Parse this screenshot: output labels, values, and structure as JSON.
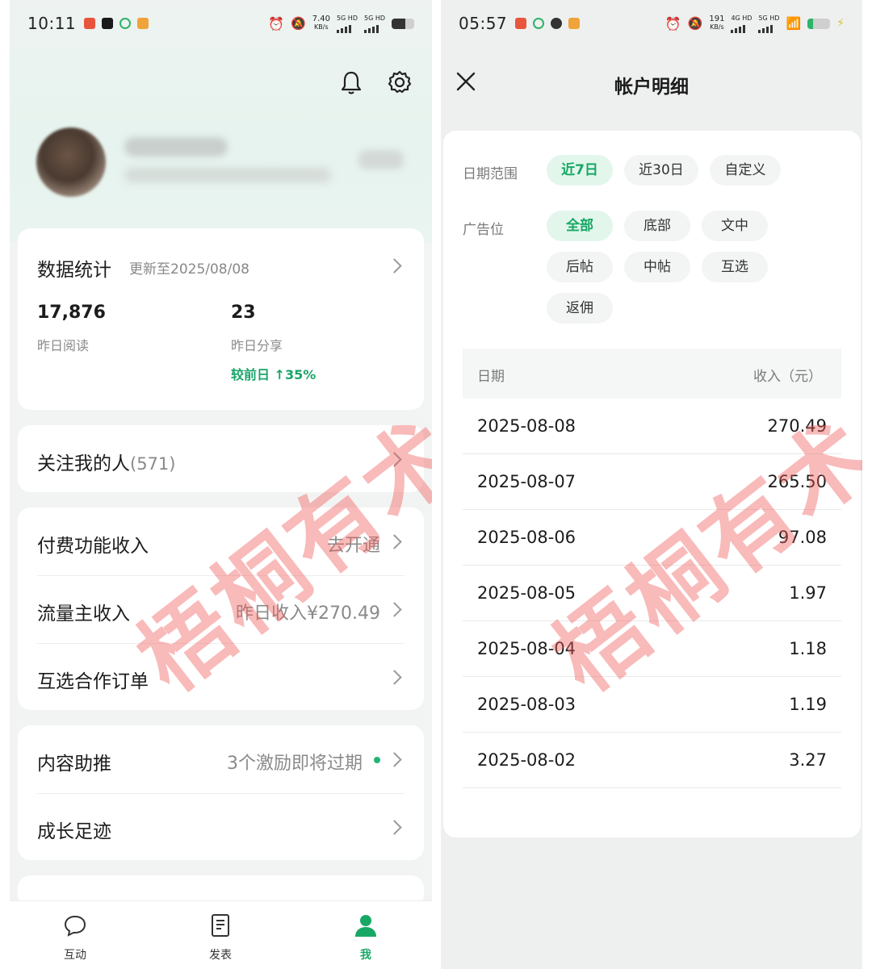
{
  "left": {
    "status": {
      "time": "10:11",
      "net_speed": "7.40",
      "net_unit": "KB/s",
      "sim1": "5G HD",
      "sim2": "5G HD"
    },
    "stats": {
      "title": "数据统计",
      "updated": "更新至2025/08/08",
      "reads_value": "17,876",
      "reads_label": "昨日阅读",
      "shares_value": "23",
      "shares_label": "昨日分享",
      "shares_compare": "较前日 ↑35%"
    },
    "followers": {
      "label": "关注我的人",
      "count": "(571)"
    },
    "menu": [
      {
        "label": "付费功能收入",
        "value": "去开通"
      },
      {
        "label": "流量主收入",
        "value": "昨日收入¥270.49"
      },
      {
        "label": "互选合作订单",
        "value": ""
      }
    ],
    "menu2": [
      {
        "label": "内容助推",
        "value": "3个激励即将过期"
      },
      {
        "label": "成长足迹",
        "value": ""
      }
    ],
    "tabs": [
      {
        "label": "互动",
        "icon": "chat-bubble-icon",
        "active": false
      },
      {
        "label": "发表",
        "icon": "document-icon",
        "active": false
      },
      {
        "label": "我",
        "icon": "person-icon",
        "active": true
      }
    ]
  },
  "right": {
    "status": {
      "time": "05:57",
      "net_speed": "191",
      "net_unit": "KB/s",
      "sim1": "4G HD",
      "sim2": "5G HD"
    },
    "title": "帐户明细",
    "date_range_label": "日期范围",
    "date_ranges": [
      {
        "label": "近7日",
        "active": true
      },
      {
        "label": "近30日",
        "active": false
      },
      {
        "label": "自定义",
        "active": false
      }
    ],
    "ad_position_label": "广告位",
    "ad_positions": [
      {
        "label": "全部",
        "active": true
      },
      {
        "label": "底部",
        "active": false
      },
      {
        "label": "文中",
        "active": false
      },
      {
        "label": "后帖",
        "active": false
      },
      {
        "label": "中帖",
        "active": false
      },
      {
        "label": "互选",
        "active": false
      },
      {
        "label": "返佣",
        "active": false
      }
    ],
    "table": {
      "col_date": "日期",
      "col_income": "收入（元）",
      "rows": [
        {
          "date": "2025-08-08",
          "income": "270.49"
        },
        {
          "date": "2025-08-07",
          "income": "265.50"
        },
        {
          "date": "2025-08-06",
          "income": "97.08"
        },
        {
          "date": "2025-08-05",
          "income": "1.97"
        },
        {
          "date": "2025-08-04",
          "income": "1.18"
        },
        {
          "date": "2025-08-03",
          "income": "1.19"
        },
        {
          "date": "2025-08-02",
          "income": "3.27"
        }
      ]
    }
  },
  "watermark": "梧桐有术",
  "colors": {
    "accent_green": "#18a865",
    "chip_active_bg": "#e3f6ec",
    "watermark": "#f05a5a"
  }
}
